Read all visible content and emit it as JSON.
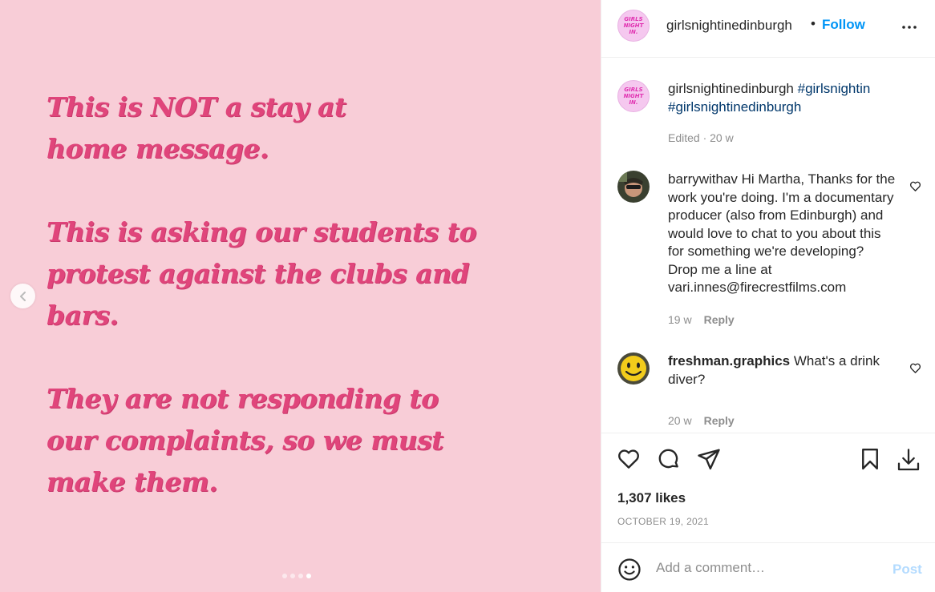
{
  "media": {
    "paragraphs": [
      [
        "This is NOT a stay at",
        "home message."
      ],
      [
        "This is asking our students to",
        "protest against the clubs and",
        "bars."
      ],
      [
        "They are not responding to",
        "our complaints, so we must",
        "make them."
      ]
    ],
    "carousel": {
      "total": 4,
      "active": 4
    },
    "background_color": "#f8cdd7",
    "text_color": "#e0457b"
  },
  "header": {
    "avatar_text": [
      "GIRLS",
      "NIGHT",
      "IN."
    ],
    "username": "girlsnightinedinburgh",
    "separator": "•",
    "follow_label": "Follow"
  },
  "caption": {
    "username": "girlsnightinedinburgh",
    "hashtags": [
      "#girlsnightin",
      "#girlsnightinedinburgh"
    ],
    "meta": "Edited · 20 w"
  },
  "comments": [
    {
      "username": "barrywithav",
      "text": "Hi Martha, Thanks for the work you're doing. I'm a documentary producer (also from Edinburgh) and would love to chat to you about this for something we're developing? Drop me a line at vari.innes@firecrestfilms.com",
      "lines": [
        "barrywithav Hi Martha, Thanks for",
        "the work you're doing. I'm a",
        "documentary producer (also from",
        "Edinburgh) and would love to chat",
        "to you about this for something",
        "we're developing? Drop me a line at",
        "vari.innes@firecrestfilms.com"
      ],
      "age": "19 w",
      "reply_label": "Reply"
    },
    {
      "username": "freshman.graphics",
      "text": "What's a drink diver?",
      "age": "20 w",
      "reply_label": "Reply"
    }
  ],
  "actions": {
    "likes": "1,307 likes",
    "date": "OCTOBER 19, 2021"
  },
  "add_comment": {
    "placeholder": "Add a comment…",
    "post_label": "Post"
  },
  "colors": {
    "accent": "#0095f6",
    "hashtag": "#00376b",
    "muted": "#8e8e8e",
    "post_disabled": "#b3dbff"
  }
}
